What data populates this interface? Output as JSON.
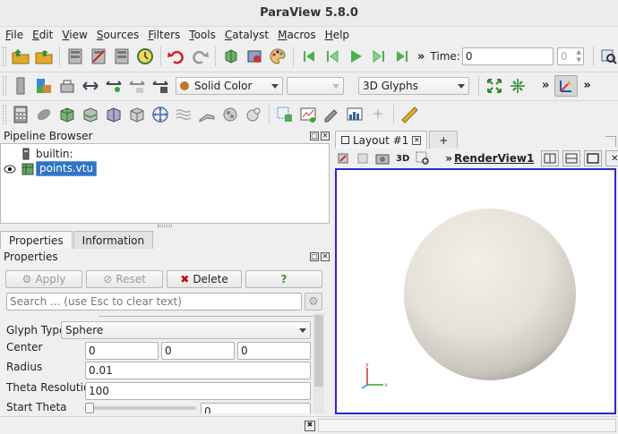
{
  "window": {
    "title": "ParaView 5.8.0"
  },
  "menu": [
    {
      "ul": "F",
      "rest": "ile"
    },
    {
      "ul": "E",
      "rest": "dit"
    },
    {
      "ul": "V",
      "rest": "iew"
    },
    {
      "ul": "S",
      "rest": "ources"
    },
    {
      "ul": "F",
      "rest": "ilters"
    },
    {
      "ul": "T",
      "rest": "ools"
    },
    {
      "ul": "C",
      "rest": "atalyst"
    },
    {
      "ul": "M",
      "rest": "acros"
    },
    {
      "ul": "H",
      "rest": "elp"
    }
  ],
  "toolbar": {
    "time_label": "Time:",
    "time_value": "0",
    "timestep_value": "0",
    "color_by": "Solid Color",
    "representation": "3D Glyphs",
    "more": "»"
  },
  "pipeline": {
    "title": "Pipeline Browser",
    "items": [
      {
        "label": "builtin:"
      },
      {
        "label": "points.vtu"
      }
    ]
  },
  "panel_tabs": {
    "properties": "Properties",
    "information": "Information"
  },
  "properties": {
    "title": "Properties",
    "apply": "Apply",
    "reset": "Reset",
    "delete": "Delete",
    "help": "?",
    "search_placeholder": "Search ... (use Esc to clear text)",
    "glyph_type_label": "Glyph Type",
    "glyph_type_value": "Sphere",
    "center_label": "Center",
    "center_x": "0",
    "center_y": "0",
    "center_z": "0",
    "radius_label": "Radius",
    "radius_value": "0.01",
    "theta_res_label": "Theta Resolution",
    "theta_res_value": "100",
    "start_theta_label": "Start Theta",
    "start_theta_value": "0"
  },
  "layout": {
    "tab_label": "Layout #1",
    "add_tab": "+",
    "view_name": "RenderView1",
    "threed_label": "3D",
    "more": "»"
  },
  "colors": {
    "selection": "#3074c6",
    "viewport_border": "#2a2ad0",
    "sphere": "#e8e4dc"
  }
}
